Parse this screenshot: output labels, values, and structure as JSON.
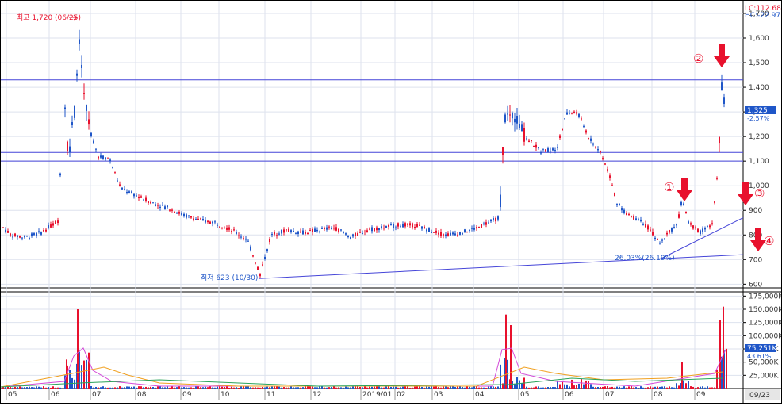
{
  "header": {
    "lc": "LC:112.68",
    "hc": "HC:-22.97"
  },
  "price_axis": {
    "ticks": [
      "1,700",
      "1,600",
      "1,500",
      "1,400",
      "1,300",
      "1,200",
      "1,100",
      "1,000",
      "900",
      "800",
      "700",
      "600"
    ],
    "current_price": "1,325",
    "current_change": "-2.57%"
  },
  "volume_axis": {
    "ticks": [
      "175,000K",
      "150,000K",
      "125,000K",
      "100,000K",
      "75,000K",
      "50,000K",
      "25,000K"
    ],
    "current_volume": "75,251K",
    "current_pct": "43.61%"
  },
  "date_axis": {
    "labels": [
      "05",
      "06",
      "07",
      "08",
      "09",
      "10",
      "11",
      "12",
      "2019/01",
      "02",
      "03",
      "04",
      "05",
      "06",
      "07",
      "08",
      "09"
    ],
    "current_date": "09/23"
  },
  "annotations": {
    "high": "최고 1,720 (06/25)",
    "low": "최저 623 (10/30)",
    "low_pct": "26.03%(26.19%)",
    "marker1": "①",
    "marker2": "②",
    "marker3": "③",
    "marker4": "④"
  },
  "colors": {
    "up": "#e8112d",
    "down": "#1f56c8",
    "trendline": "#4545d8",
    "grid": "#dde2ee",
    "arrow": "#e8112d"
  },
  "chart_data": {
    "type": "candlestick",
    "title": "",
    "price_range": [
      585,
      1745
    ],
    "volume_range": [
      0,
      180000
    ],
    "volume_unit": "K",
    "horizontal_lines": [
      1430,
      1135,
      1100
    ],
    "trendlines": [
      {
        "from": [
          "2018-10-30",
          623
        ],
        "to": [
          "2019-09-27",
          720
        ]
      },
      {
        "from": [
          "2019-08-13",
          703
        ],
        "to": [
          "2019-09-27",
          870
        ]
      }
    ],
    "high": {
      "value": 1720,
      "date": "06/25"
    },
    "low": {
      "value": 623,
      "date": "10/30"
    },
    "last_close": 1325,
    "last_volume": 75251,
    "moving_averages": [
      "magenta",
      "orange",
      "green"
    ],
    "grid": true,
    "months": [
      "05",
      "06",
      "07",
      "08",
      "09",
      "10",
      "11",
      "12",
      "2019/01",
      "02",
      "03",
      "04",
      "05",
      "06",
      "07",
      "08",
      "09"
    ]
  }
}
